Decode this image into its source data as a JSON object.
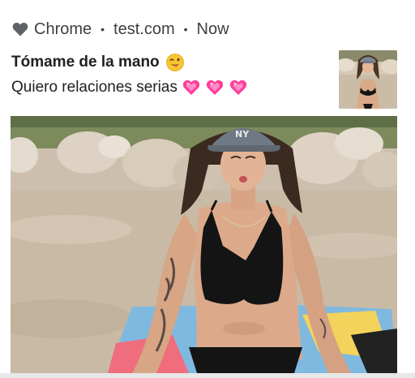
{
  "notification": {
    "app_name": "Chrome",
    "separator": "•",
    "source": "test.com",
    "time": "Now",
    "app_icon": "heart-icon",
    "title": "Tómame de la mano",
    "title_emoji": "winking-face-tongue-emoji",
    "body": "Quiero relaciones serias",
    "body_emoji": [
      "pink-heart-emoji",
      "pink-heart-emoji",
      "pink-heart-emoji"
    ],
    "colors": {
      "text_primary": "#202124",
      "text_secondary": "#3c4043",
      "heart_pink": "#ff3d9a",
      "icon_gray": "#5f6368"
    }
  }
}
